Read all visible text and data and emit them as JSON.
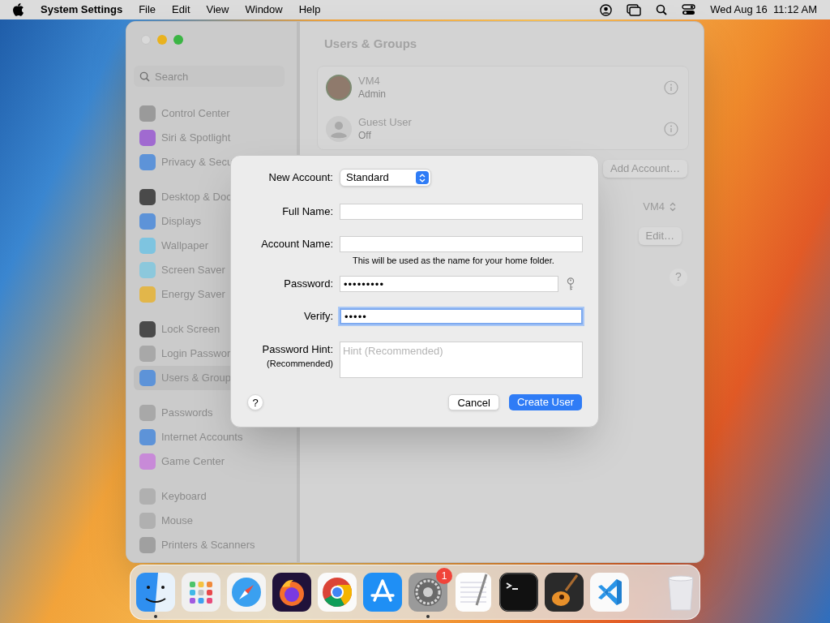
{
  "menu_bar": {
    "app": "System Settings",
    "menus": [
      "File",
      "Edit",
      "View",
      "Window",
      "Help"
    ],
    "clock": "Wed Aug 16  11:12 AM"
  },
  "window": {
    "title": "Users & Groups"
  },
  "sidebar": {
    "search_placeholder": "Search",
    "sections": [
      [
        {
          "label": "Control Center",
          "color": "#9a9a9a",
          "selected": false
        },
        {
          "label": "Siri & Spotlight",
          "color": "#a06ad0",
          "selected": false
        },
        {
          "label": "Privacy & Secu",
          "color": "#5d93d8",
          "selected": false
        }
      ],
      [
        {
          "label": "Desktop & Doc",
          "color": "#4a4a4a",
          "selected": false
        },
        {
          "label": "Displays",
          "color": "#5d93d8",
          "selected": false
        },
        {
          "label": "Wallpaper",
          "color": "#7ec4e0",
          "selected": false
        },
        {
          "label": "Screen Saver",
          "color": "#8cc8dc",
          "selected": false
        },
        {
          "label": "Energy Saver",
          "color": "#e2b64a",
          "selected": false
        }
      ],
      [
        {
          "label": "Lock Screen",
          "color": "#4a4a4a",
          "selected": false
        },
        {
          "label": "Login Passwor",
          "color": "#a8a8a8",
          "selected": false
        },
        {
          "label": "Users & Group",
          "color": "#5d93d8",
          "selected": true
        }
      ],
      [
        {
          "label": "Passwords",
          "color": "#a8a8a8",
          "selected": false
        },
        {
          "label": "Internet Accounts",
          "color": "#5d93d8",
          "selected": false
        },
        {
          "label": "Game Center",
          "color": "#c88ad8",
          "selected": false
        }
      ],
      [
        {
          "label": "Keyboard",
          "color": "#b0b0b0",
          "selected": false
        },
        {
          "label": "Mouse",
          "color": "#b0b0b0",
          "selected": false
        },
        {
          "label": "Printers & Scanners",
          "color": "#a0a0a0",
          "selected": false
        }
      ]
    ]
  },
  "users": [
    {
      "name": "VM4",
      "role": "Admin",
      "kind": "photo"
    },
    {
      "name": "Guest User",
      "role": "Off",
      "kind": "guest"
    }
  ],
  "add_account_button": "Add Account…",
  "auto_login": {
    "value": "VM4"
  },
  "edit_button": "Edit…",
  "help_button": "?",
  "dialog": {
    "rows": [
      {
        "kind": "popup",
        "label": "New Account:",
        "value": "Standard"
      },
      {
        "kind": "text",
        "label": "Full Name:",
        "focused": false
      },
      {
        "kind": "text",
        "label": "Account Name:",
        "focused": false,
        "note": "This will be used as the name for your home folder."
      },
      {
        "kind": "password",
        "label": "Password:",
        "value": "•••••••••",
        "focused": false
      },
      {
        "kind": "text",
        "label": "Verify:",
        "value": "•••••",
        "focused": true
      },
      {
        "kind": "hint",
        "label": "Password Hint:",
        "sublabel": "(Recommended)",
        "placeholder": "Hint (Recommended)"
      }
    ],
    "help_button": "?",
    "cancel_button": "Cancel",
    "create_button": "Create User"
  },
  "dock": {
    "items": [
      {
        "kind": "finder",
        "running": true
      },
      {
        "kind": "launchpad",
        "running": false
      },
      {
        "kind": "safari",
        "running": false
      },
      {
        "kind": "firefox",
        "running": false
      },
      {
        "kind": "chrome",
        "running": false
      },
      {
        "kind": "appstore",
        "running": false
      },
      {
        "kind": "settings",
        "running": true,
        "badge": "1"
      },
      {
        "kind": "textedit",
        "running": false
      },
      {
        "kind": "terminal",
        "running": false
      },
      {
        "kind": "garageband",
        "running": false
      },
      {
        "kind": "vscode",
        "running": false
      },
      {
        "kind": "separator"
      },
      {
        "kind": "trash",
        "running": false
      }
    ]
  }
}
